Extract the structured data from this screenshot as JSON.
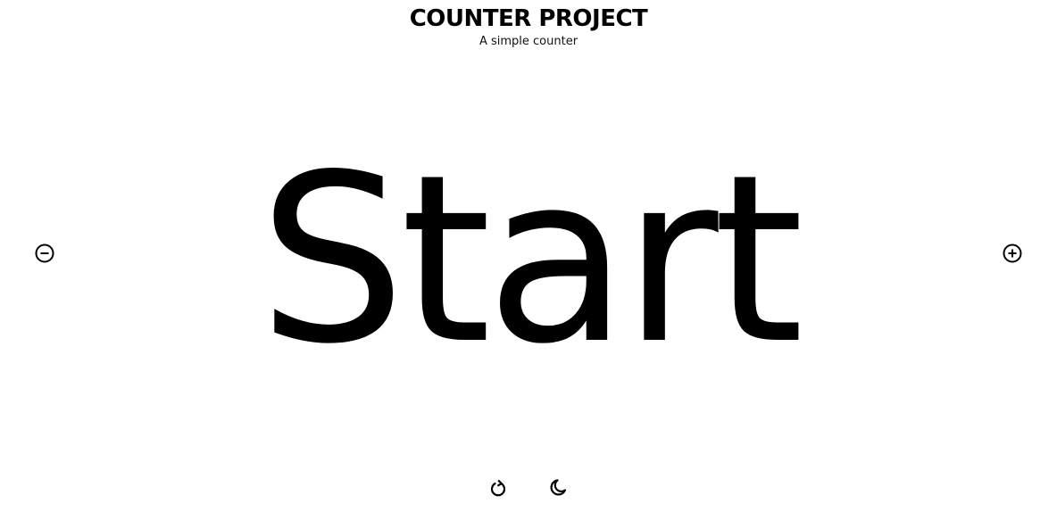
{
  "header": {
    "title": "COUNTER PROJECT",
    "subtitle": "A simple counter"
  },
  "counter": {
    "display": "Start"
  },
  "controls": {
    "decrement_icon": "minus-circle-icon",
    "increment_icon": "plus-circle-icon",
    "reset_icon": "rotate-icon",
    "theme_icon": "moon-icon"
  }
}
